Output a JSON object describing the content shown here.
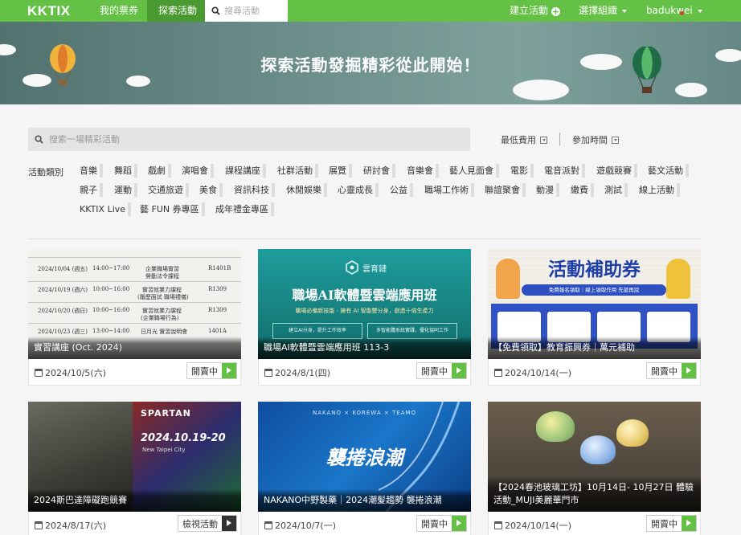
{
  "nav": {
    "logo": "KKTIX",
    "my_tickets": "我的票券",
    "explore": "探索活動",
    "search_placeholder": "搜尋活動",
    "create_event": "建立活動",
    "choose_org": "選擇組織",
    "username": "badukwei"
  },
  "banner": {
    "title": "探索活動發掘精彩從此開始！"
  },
  "search": {
    "placeholder": "搜索一場精彩活動",
    "sort_fee": "最低費用",
    "sort_time": "參加時間"
  },
  "categories": {
    "label": "活動類別",
    "tags": [
      "音樂",
      "舞蹈",
      "戲劇",
      "演唱會",
      "課程講座",
      "社群活動",
      "展覽",
      "研討會",
      "音樂會",
      "藝人見面會",
      "電影",
      "電音派對",
      "遊戲競賽",
      "藝文活動",
      "親子",
      "運動",
      "交通旅遊",
      "美食",
      "資訊科技",
      "休閒娛樂",
      "心靈成長",
      "公益",
      "職場工作術",
      "聯誼聚會",
      "動漫",
      "繳費",
      "測試",
      "線上活動",
      "KKTIX Live",
      "藝 FUN 券專區",
      "成年禮金專區"
    ]
  },
  "events": [
    {
      "title": "實習講座 (Oct. 2024)",
      "date": "2024/10/5(六)",
      "status": "開賣中",
      "image_rows": [
        [
          "2024/10/04 (週五)",
          "14:00~17:00",
          "企業職場實習",
          "R1401B"
        ],
        [
          "",
          "",
          "勞動法令課程",
          ""
        ],
        [
          "2024/10/19 (週六)",
          "10:00~16:00",
          "實習就業力課程",
          "R1309"
        ],
        [
          "",
          "",
          "(履歷面試 職場禮儀)",
          ""
        ],
        [
          "2024/10/20 (週日)",
          "10:00~16:00",
          "實習就業力課程",
          "R1309"
        ],
        [
          "",
          "",
          "(企業職場行為)",
          ""
        ],
        [
          "2024/10/23 (週三)",
          "13:00~14:00",
          "日月光 實習說明會",
          "1401A"
        ]
      ]
    },
    {
      "title": "職場AI軟體暨雲端應用班 113-3",
      "date": "2024/8/1(四)",
      "status": "開賣中",
      "image_brand": "雲育鏈",
      "image_headline": "職場AI軟體暨雲端應用班",
      "image_subline": "職場必備新技能 - 擁有 AI 智能雙分身，創造十倍生產力",
      "image_box1": "建立AI分身，提升工作效率",
      "image_box2": "多智能體系統實踐，優化協同工作"
    },
    {
      "title": "【免費領取】教育振興券｜萬元補助",
      "date": "2024/10/14(一)",
      "status": "開賣中",
      "image_headline": "活動補助券",
      "image_ribbon": "免費報名領取｜線上領取作用 先搶再說"
    },
    {
      "title": "2024斯巴達障礙跑競賽",
      "date": "2024/8/17(六)",
      "status": "檢視活動",
      "image_brand": "SPARTAN",
      "image_dates": "2024.10.19-20",
      "image_sub": "New Taipei City"
    },
    {
      "title": "NAKANO中野製藥｜2024潮髮趨勢 襲捲浪潮",
      "date": "2024/10/7(一)",
      "status": "開賣中",
      "image_top": "NAKANO × KOREWA × TEAMO",
      "image_headline": "襲捲浪潮"
    },
    {
      "title": "【2024春池玻璃工坊】10月14日- 10月27日 體驗活動_MUJI美麗華門市",
      "date": "2024/10/14(一)",
      "status": "開賣中"
    }
  ],
  "colors": {
    "brand_green": "#65c146",
    "active_nav": "#4a9a32",
    "dark_button": "#333333"
  }
}
